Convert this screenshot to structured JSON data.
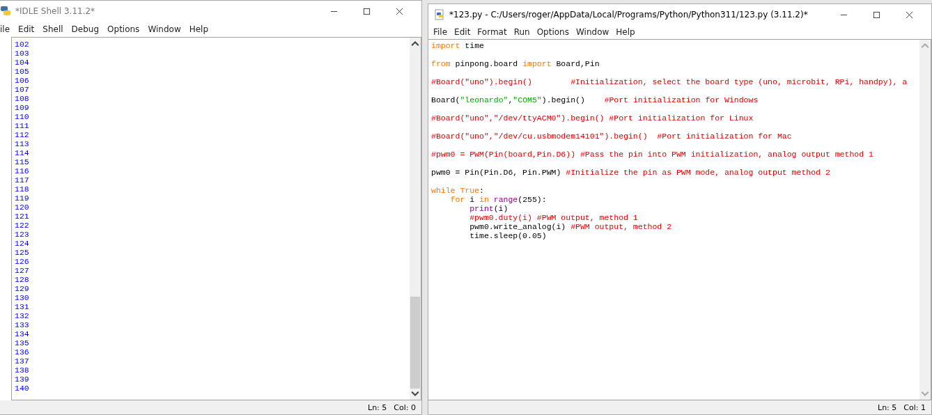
{
  "shell": {
    "title": "*IDLE Shell 3.11.2*",
    "menu": [
      "ile",
      "Edit",
      "Shell",
      "Debug",
      "Options",
      "Window",
      "Help"
    ],
    "lines": [
      "102",
      "103",
      "104",
      "105",
      "106",
      "107",
      "108",
      "109",
      "110",
      "111",
      "112",
      "113",
      "114",
      "115",
      "116",
      "117",
      "118",
      "119",
      "120",
      "121",
      "122",
      "123",
      "124",
      "125",
      "126",
      "127",
      "128",
      "129",
      "130",
      "131",
      "132",
      "133",
      "134",
      "135",
      "136",
      "137",
      "138",
      "139",
      "140"
    ],
    "status": {
      "line": "Ln: 5",
      "col": "Col: 0"
    }
  },
  "editor": {
    "title": "*123.py - C:/Users/roger/AppData/Local/Programs/Python/Python311/123.py (3.11.2)*",
    "menu": [
      "File",
      "Edit",
      "Format",
      "Run",
      "Options",
      "Window",
      "Help"
    ],
    "lines": [
      {
        "kind": "code",
        "tokens": [
          {
            "kind": "keyword",
            "text": "import"
          },
          {
            "kind": "plain",
            "text": " time"
          }
        ]
      },
      {
        "kind": "blank"
      },
      {
        "kind": "code",
        "tokens": [
          {
            "kind": "keyword",
            "text": "from"
          },
          {
            "kind": "plain",
            "text": " pinpong.board "
          },
          {
            "kind": "keyword",
            "text": "import"
          },
          {
            "kind": "plain",
            "text": " Board,Pin"
          }
        ]
      },
      {
        "kind": "blank"
      },
      {
        "kind": "code",
        "tokens": [
          {
            "kind": "comment",
            "text": "#Board(\"uno\").begin()        #Initialization, select the board type (uno, microbit, RPi, handpy), a"
          }
        ]
      },
      {
        "kind": "blank"
      },
      {
        "kind": "code",
        "tokens": [
          {
            "kind": "plain",
            "text": "Board("
          },
          {
            "kind": "string",
            "text": "\"leonardo\""
          },
          {
            "kind": "plain",
            "text": ","
          },
          {
            "kind": "string",
            "text": "\"COM5\""
          },
          {
            "kind": "plain",
            "text": ").begin()    "
          },
          {
            "kind": "comment",
            "text": "#Port initialization for Windows"
          }
        ]
      },
      {
        "kind": "blank"
      },
      {
        "kind": "code",
        "tokens": [
          {
            "kind": "comment",
            "text": "#Board(\"uno\",\"/dev/ttyACM0\").begin() #Port initialization for Linux"
          }
        ]
      },
      {
        "kind": "blank"
      },
      {
        "kind": "code",
        "tokens": [
          {
            "kind": "comment",
            "text": "#Board(\"uno\",\"/dev/cu.usbmodem14101\").begin()  #Port initialization for Mac"
          }
        ]
      },
      {
        "kind": "blank"
      },
      {
        "kind": "code",
        "tokens": [
          {
            "kind": "comment",
            "text": "#pwm0 = PWM(Pin(board,Pin.D6)) #Pass the pin into PWM initialization, analog output method 1"
          }
        ]
      },
      {
        "kind": "blank"
      },
      {
        "kind": "code",
        "tokens": [
          {
            "kind": "plain",
            "text": "pwm0 = Pin(Pin.D6, Pin.PWM) "
          },
          {
            "kind": "comment",
            "text": "#Initialize the pin as PWM mode, analog output method 2"
          }
        ]
      },
      {
        "kind": "blank"
      },
      {
        "kind": "code",
        "tokens": [
          {
            "kind": "keyword",
            "text": "while"
          },
          {
            "kind": "keyword",
            "text": " True"
          },
          {
            "kind": "plain",
            "text": ":"
          }
        ]
      },
      {
        "kind": "code",
        "tokens": [
          {
            "kind": "keyword",
            "text": "    for"
          },
          {
            "kind": "plain",
            "text": " i "
          },
          {
            "kind": "keyword",
            "text": "in"
          },
          {
            "kind": "builtin",
            "text": " range"
          },
          {
            "kind": "plain",
            "text": "(255):"
          }
        ]
      },
      {
        "kind": "code",
        "tokens": [
          {
            "kind": "builtin",
            "text": "        print"
          },
          {
            "kind": "plain",
            "text": "(i)"
          }
        ]
      },
      {
        "kind": "code",
        "tokens": [
          {
            "kind": "comment",
            "text": "        #pwm0.duty(i) #PWM output, method 1"
          }
        ]
      },
      {
        "kind": "code",
        "tokens": [
          {
            "kind": "plain",
            "text": "        pwm0.write_analog(i) "
          },
          {
            "kind": "comment",
            "text": "#PWM output, method 2"
          }
        ]
      },
      {
        "kind": "code",
        "tokens": [
          {
            "kind": "plain",
            "text": "        time.sleep(0.05)"
          }
        ]
      }
    ],
    "status": {
      "line": "Ln: 5",
      "col": "Col: 1"
    }
  }
}
